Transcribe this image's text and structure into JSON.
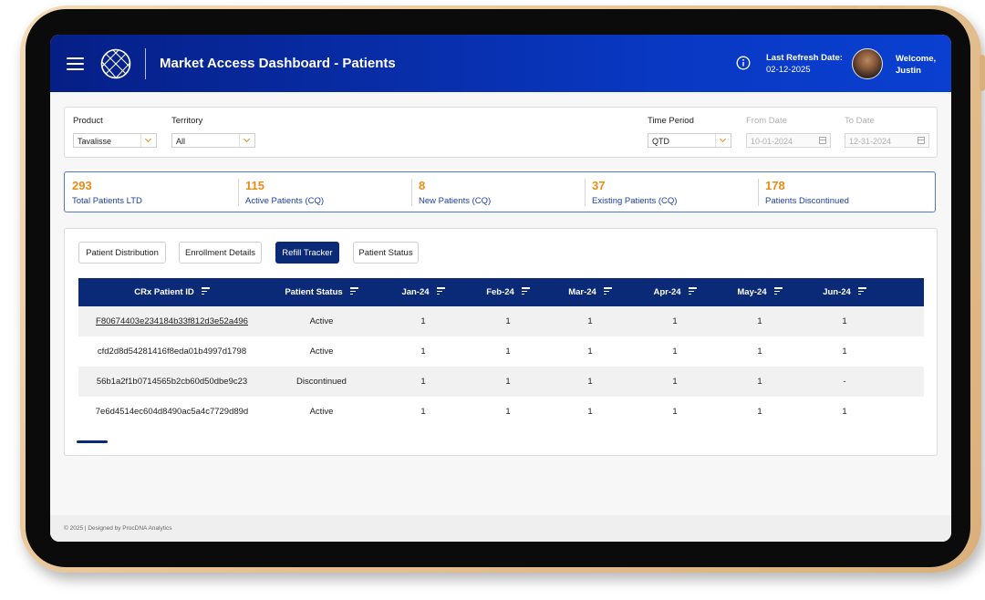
{
  "header": {
    "title": "Market Access Dashboard - Patients",
    "refresh_label": "Last Refresh Date:",
    "refresh_date": "02-12-2025",
    "welcome_line1": "Welcome,",
    "welcome_line2": "Justin",
    "icons": [
      "hamburger-menu-icon",
      "globe-logo-icon",
      "info-icon"
    ]
  },
  "filters": {
    "product_label": "Product",
    "product_value": "Tavalisse",
    "territory_label": "Territory",
    "territory_value": "All",
    "time_period_label": "Time Period",
    "time_period_value": "QTD",
    "from_date_label": "From Date",
    "from_date_value": "10-01-2024",
    "to_date_label": "To Date",
    "to_date_value": "12-31-2024"
  },
  "kpis": [
    {
      "value": "293",
      "label": "Total Patients LTD"
    },
    {
      "value": "115",
      "label": "Active Patients (CQ)"
    },
    {
      "value": "8",
      "label": "New Patients (CQ)"
    },
    {
      "value": "37",
      "label": "Existing Patients (CQ)"
    },
    {
      "value": "178",
      "label": "Patients Discontinued"
    }
  ],
  "tabs": [
    {
      "label": "Patient Distribution"
    },
    {
      "label": "Enrollment Details"
    },
    {
      "label": "Refill Tracker"
    },
    {
      "label": "Patient Status"
    }
  ],
  "active_tab": "Refill Tracker",
  "table": {
    "columns": [
      "CRx Patient ID",
      "Patient Status",
      "Jan-24",
      "Feb-24",
      "Mar-24",
      "Apr-24",
      "May-24",
      "Jun-24"
    ],
    "rows": [
      [
        "F80674403e234184b33f812d3e52a496",
        "Active",
        "1",
        "1",
        "1",
        "1",
        "1",
        "1"
      ],
      [
        "cfd2d8d54281416f8eda01b4997d1798",
        "Active",
        "1",
        "1",
        "1",
        "1",
        "1",
        "1"
      ],
      [
        "56b1a2f1b0714565b2cb60d50dbe9c23",
        "Discontinued",
        "1",
        "1",
        "1",
        "1",
        "1",
        "-"
      ],
      [
        "7e6d4514ec604d8490ac5a4c7729d89d",
        "Active",
        "1",
        "1",
        "1",
        "1",
        "1",
        "1"
      ]
    ]
  },
  "footer": {
    "text": "© 2025 | Designed by ProcDNA Analytics"
  },
  "colors": {
    "header_start": "#061f86",
    "header_end": "#0a3fd0",
    "accent_orange": "#ea8c14",
    "table_header": "#0a2a78",
    "kpi_label": "#1d3ea8"
  }
}
